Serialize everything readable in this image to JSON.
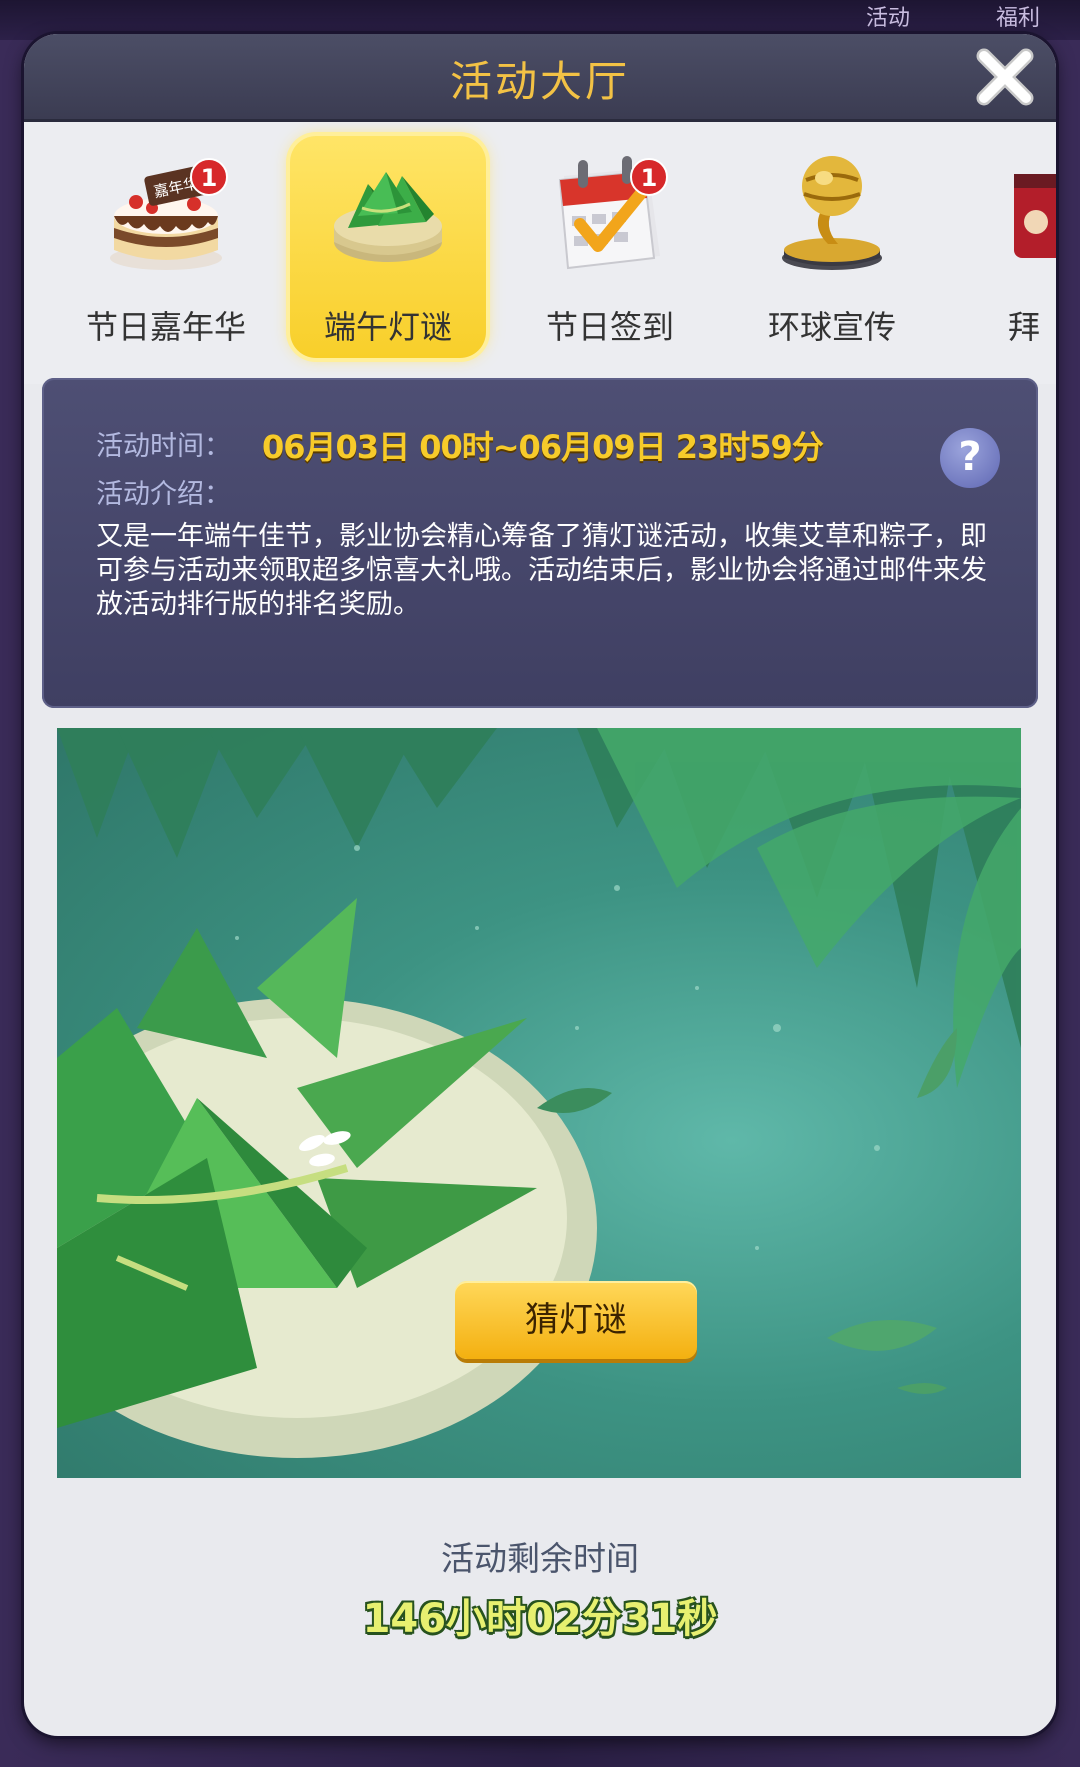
{
  "background": {
    "top_labels": [
      "活动",
      "福利"
    ]
  },
  "modal": {
    "title": "活动大厅",
    "close_icon": "close-icon"
  },
  "tabs": [
    {
      "label": "节日嘉年华",
      "icon": "cake-icon",
      "badge": "1",
      "cake_text": "嘉年华",
      "active": false
    },
    {
      "label": "端午灯谜",
      "icon": "zongzi-icon",
      "badge": "",
      "active": true
    },
    {
      "label": "节日签到",
      "icon": "calendar-check-icon",
      "badge": "1",
      "active": false
    },
    {
      "label": "环球宣传",
      "icon": "globe-trophy-icon",
      "badge": "",
      "active": false
    },
    {
      "label": "拜",
      "icon": "gift-icon",
      "badge": "",
      "active": false
    }
  ],
  "info": {
    "time_label": "活动时间：",
    "time_value": "06月03日 00时~06月09日 23时59分",
    "intro_label": "活动介绍：",
    "intro_text": "又是一年端午佳节，影业协会精心筹备了猜灯谜活动，收集艾草和粽子，即可参与活动来领取超多惊喜大礼哦。活动结束后，影业协会将通过邮件来发放活动排行版的排名奖励。",
    "help_label": "?"
  },
  "banner": {
    "button_label": "猜灯谜"
  },
  "countdown": {
    "label": "活动剩余时间",
    "value": "146小时02分31秒"
  },
  "colors": {
    "title": "#f3c245",
    "time_value": "#f7cb2a",
    "countdown": "#e7f070",
    "active_tab": "#f8cf2a",
    "badge": "#d7282a"
  }
}
